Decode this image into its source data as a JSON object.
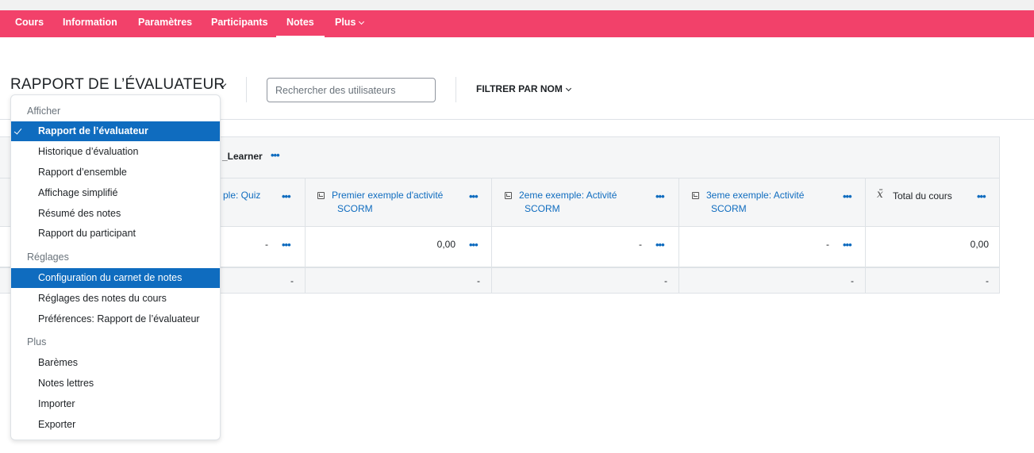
{
  "nav": {
    "items": [
      "Cours",
      "Information",
      "Paramètres",
      "Participants",
      "Notes"
    ],
    "more_label": "Plus",
    "active": "Notes"
  },
  "header": {
    "title": "RAPPORT DE L’ÉVALUATEUR",
    "search_placeholder": "Rechercher des utilisateurs",
    "filter_label": "FILTRER PAR NOM"
  },
  "table": {
    "category_label": "_Learner",
    "columns": [
      {
        "label": "ple: Quiz"
      },
      {
        "label": "Premier exemple d'activité",
        "label2": "SCORM"
      },
      {
        "label": "2eme exemple: Activité",
        "label2": "SCORM"
      },
      {
        "label": "3eme exemple: Activité",
        "label2": "SCORM"
      },
      {
        "label": "Total du cours"
      }
    ],
    "row_values": [
      "-",
      "0,00",
      "-",
      "-",
      "0,00"
    ],
    "avg_values": [
      "-",
      "-",
      "-",
      "-",
      "-"
    ]
  },
  "menu": {
    "section_afficher": "Afficher",
    "afficher_items": [
      "Rapport de l’évaluateur",
      "Historique d’évaluation",
      "Rapport d’ensemble",
      "Affichage simplifié",
      "Résumé des notes",
      "Rapport du participant"
    ],
    "section_reglages": "Réglages",
    "reglages_items": [
      "Configuration du carnet de notes",
      "Réglages des notes du cours",
      "Préférences: Rapport de l’évaluateur"
    ],
    "section_plus": "Plus",
    "plus_items": [
      "Barèmes",
      "Notes lettres",
      "Importer",
      "Exporter"
    ]
  },
  "colors": {
    "nav_bg": "#f2416a",
    "accent": "#0f6cbf"
  }
}
